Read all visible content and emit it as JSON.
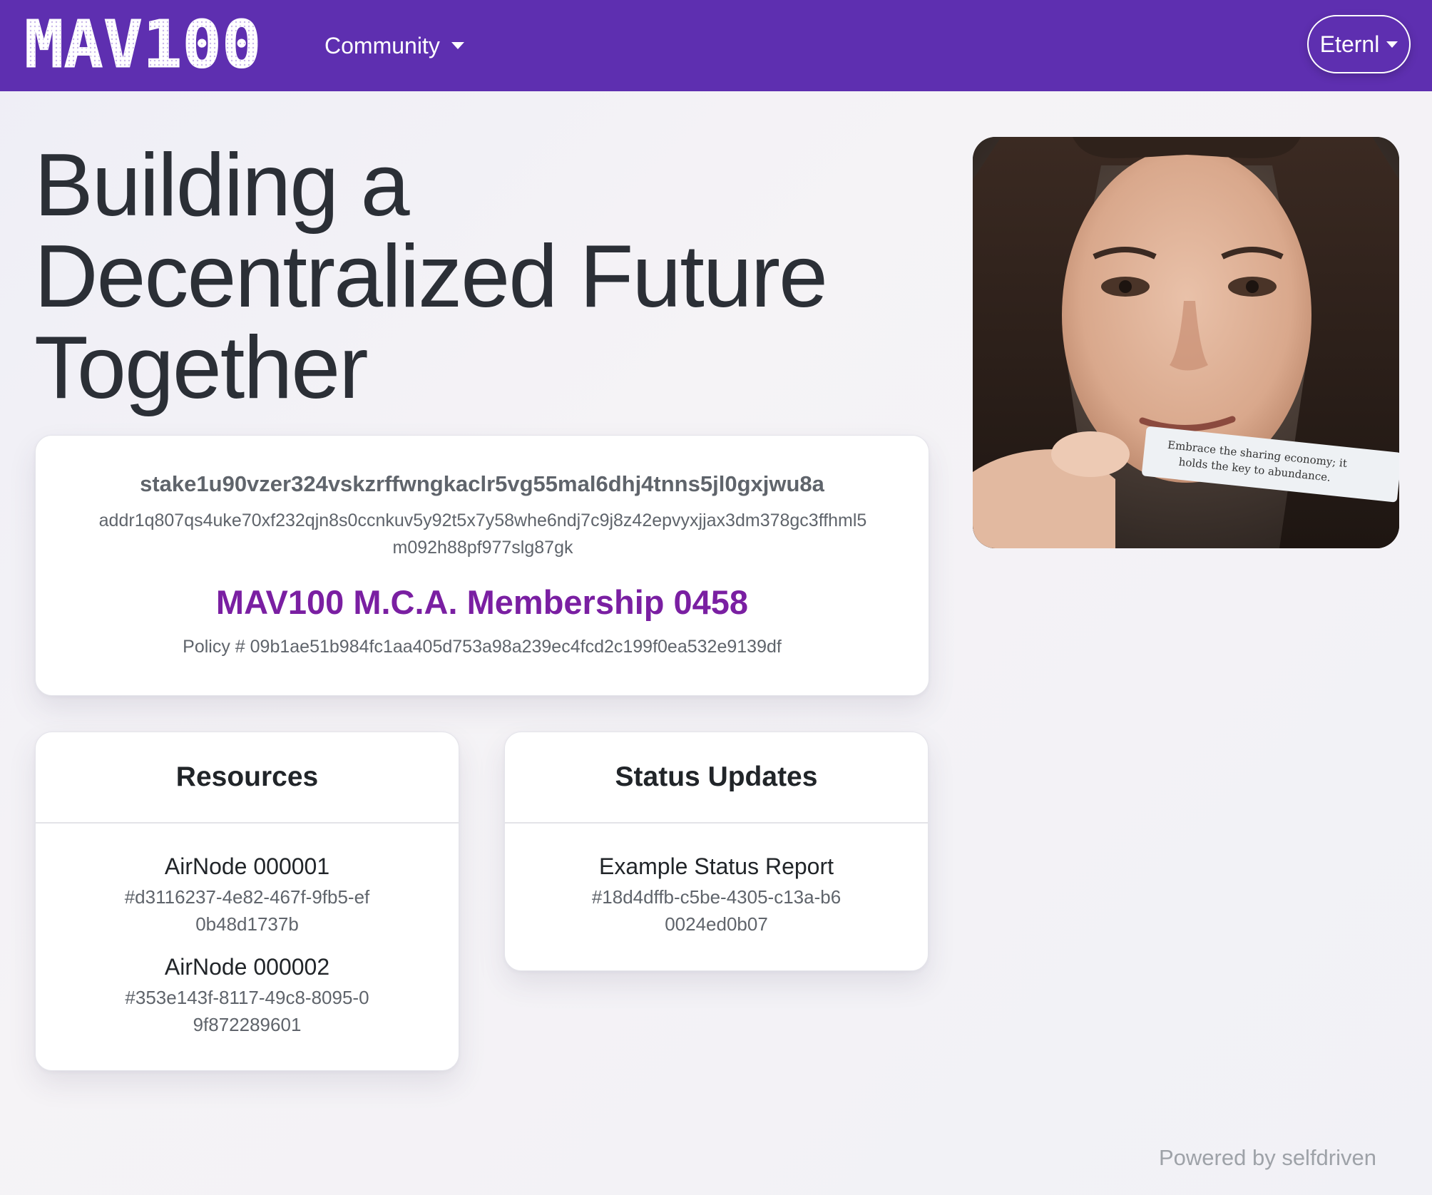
{
  "navbar": {
    "logo_text": "MAV100",
    "community_label": "Community",
    "wallet_label": "Eternl",
    "background": "#5e2fb0"
  },
  "hero": {
    "title": "Building a Decentralized Future Together"
  },
  "nft_card": {
    "stake_address": "stake1u90vzer324vskzrffwngkaclr5vg55mal6dhj4tnns5jl0gxjwu8a",
    "payment_address": "addr1q807qs4uke70xf232qjn8s0ccnkuv5y92t5x7y58whe6ndj7c9j8z42epvyxjjax3dm378gc3ffhml5m092h88pf977slg87gk",
    "name": "MAV100 M.C.A. Membership 0458",
    "policy": "Policy # 09b1ae51b984fc1aa405d753a98a239ec4fcd2c199f0ea532e9139df",
    "name_color": "#7a1fa2"
  },
  "photo": {
    "slip_text_line1": "Embrace the sharing economy; it",
    "slip_text_line2": "holds the key to abundance."
  },
  "resources": {
    "title": "Resources",
    "items": [
      {
        "name": "AirNode 000001",
        "id": "#d3116237-4e82-467f-9fb5-ef0b48d1737b"
      },
      {
        "name": "AirNode 000002",
        "id": "#353e143f-8117-49c8-8095-09f872289601"
      }
    ]
  },
  "status_updates": {
    "title": "Status Updates",
    "items": [
      {
        "name": "Example Status Report",
        "id": "#18d4dffb-c5be-4305-c13a-b60024ed0b07"
      }
    ]
  },
  "footer": {
    "text": "Powered by selfdriven"
  }
}
